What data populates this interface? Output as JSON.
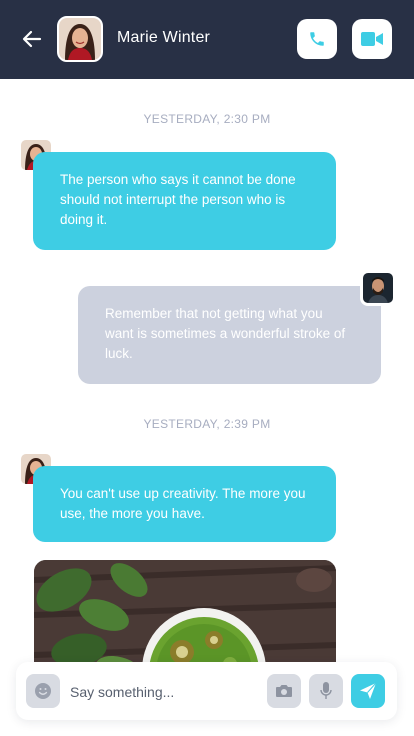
{
  "header": {
    "contact_name": "Marie Winter",
    "background": "#283045"
  },
  "colors": {
    "accent": "#3ecde4",
    "outgoing_bubble": "#ccd1de",
    "timestamp": "#a7adc0"
  },
  "icons": {
    "back": "arrow-left-icon",
    "call": "phone-icon",
    "video": "video-camera-icon",
    "emoji": "smiley-icon",
    "camera": "camera-icon",
    "mic": "microphone-icon",
    "send": "paper-plane-icon"
  },
  "messages": {
    "timestamp_1": "YESTERDAY, 2:30 PM",
    "msg_1": "The person who says it cannot be done should not interrupt the person who is doing it.",
    "msg_2": "Remember that not getting what you want is sometimes a wonderful stroke of luck.",
    "timestamp_2": "YESTERDAY, 2:39 PM",
    "msg_3": "You can't use up creativity. The more you use, the more you have."
  },
  "composer": {
    "placeholder": "Say something..."
  }
}
